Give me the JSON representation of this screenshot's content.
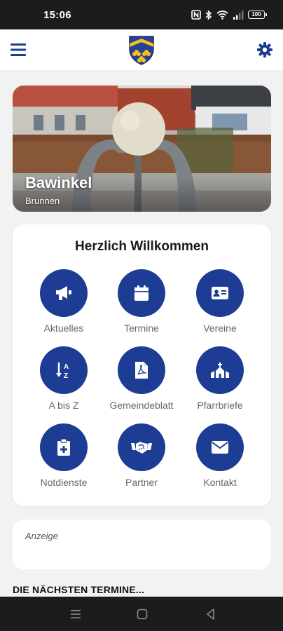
{
  "status_bar": {
    "time": "15:06",
    "battery": "100"
  },
  "app_bar": {
    "menu_icon": "hamburger-menu-icon",
    "logo": "coat-of-arms-crest",
    "settings_icon": "gear-icon"
  },
  "hero": {
    "title": "Bawinkel",
    "subtitle": "Brunnen"
  },
  "welcome": {
    "title": "Herzlich Willkommen",
    "tiles": [
      {
        "label": "Aktuelles",
        "icon": "megaphone-icon"
      },
      {
        "label": "Termine",
        "icon": "calendar-icon"
      },
      {
        "label": "Vereine",
        "icon": "id-card-icon"
      },
      {
        "label": "A bis Z",
        "icon": "sort-alpha-icon"
      },
      {
        "label": "Gemeindeblatt",
        "icon": "pdf-file-icon"
      },
      {
        "label": "Pfarrbriefe",
        "icon": "church-icon"
      },
      {
        "label": "Notdienste",
        "icon": "medical-clipboard-icon"
      },
      {
        "label": "Partner",
        "icon": "handshake-icon"
      },
      {
        "label": "Kontakt",
        "icon": "envelope-icon"
      }
    ]
  },
  "ad": {
    "label": "Anzeige"
  },
  "next_events": {
    "heading": "DIE NÄCHSTEN TERMINE..."
  },
  "colors": {
    "primary": "#1d3d94",
    "background": "#f2f2f2",
    "status_bar": "#1c1c1c"
  }
}
